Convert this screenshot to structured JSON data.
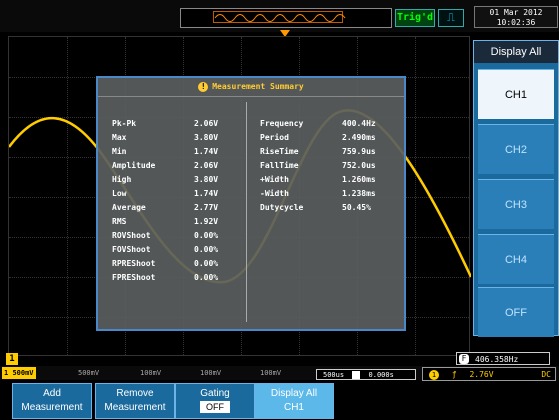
{
  "header": {
    "trigger_status": "Trig'd",
    "date": "01 Mar 2012",
    "time": "10:02:36"
  },
  "measurement": {
    "title": "Measurement Summary",
    "left": [
      {
        "label": "Pk-Pk",
        "value": "2.06V"
      },
      {
        "label": "Max",
        "value": "3.80V"
      },
      {
        "label": "Min",
        "value": "1.74V"
      },
      {
        "label": "Amplitude",
        "value": "2.06V"
      },
      {
        "label": "High",
        "value": "3.80V"
      },
      {
        "label": "Low",
        "value": "1.74V"
      },
      {
        "label": "Average",
        "value": "2.77V"
      },
      {
        "label": "RMS",
        "value": "1.92V"
      },
      {
        "label": "ROVShoot",
        "value": "0.00%"
      },
      {
        "label": "FOVShoot",
        "value": "0.00%"
      },
      {
        "label": "RPREShoot",
        "value": "0.00%"
      },
      {
        "label": "FPREShoot",
        "value": "0.00%"
      }
    ],
    "right": [
      {
        "label": "Frequency",
        "value": "400.4Hz"
      },
      {
        "label": "Period",
        "value": "2.490ms"
      },
      {
        "label": "RiseTime",
        "value": "759.9us"
      },
      {
        "label": "FallTime",
        "value": "752.0us"
      },
      {
        "label": "+Width",
        "value": "1.260ms"
      },
      {
        "label": "-Width",
        "value": "1.238ms"
      },
      {
        "label": "Dutycycle",
        "value": "50.45%"
      }
    ]
  },
  "sidebar": {
    "title": "Display All",
    "items": [
      {
        "label": "CH1"
      },
      {
        "label": "CH2"
      },
      {
        "label": "CH3"
      },
      {
        "label": "CH4"
      },
      {
        "label": "OFF"
      }
    ]
  },
  "status": {
    "ch1_scale": "500mV",
    "ch2_scale": "500mV",
    "ch3_scale": "100mV",
    "ch4_scale": "100mV",
    "ch5_scale": "100mV",
    "timebase": "500us",
    "position": "0.000s",
    "frequency": "406.358Hz",
    "trigger_level": "2.76V",
    "coupling": "DC",
    "ch_marker": "1"
  },
  "softkeys": [
    {
      "line1": "Add",
      "line2": "Measurement"
    },
    {
      "line1": "Remove",
      "line2": "Measurement"
    },
    {
      "line1": "Gating",
      "value": "OFF"
    },
    {
      "line1": "Display All",
      "value": "CH1"
    }
  ],
  "colors": {
    "waveform": "#ffcc00",
    "panel_border": "#4a88c8",
    "menu_bg": "#1b6a9e"
  }
}
